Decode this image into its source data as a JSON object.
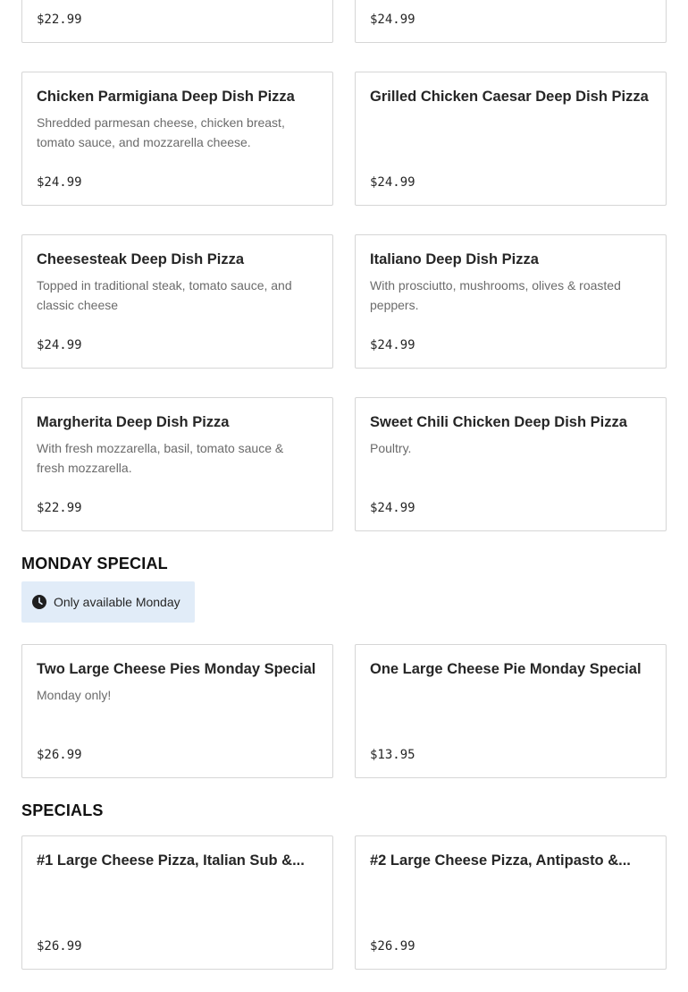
{
  "top_items": [
    {
      "price": "$22.99"
    },
    {
      "price": "$24.99"
    }
  ],
  "pizza_items": [
    {
      "name": "Chicken Parmigiana Deep Dish Pizza",
      "description": "Shredded parmesan cheese, chicken breast, tomato sauce, and mozzarella cheese.",
      "price": "$24.99"
    },
    {
      "name": "Grilled Chicken Caesar Deep Dish Pizza",
      "description": "",
      "price": "$24.99"
    },
    {
      "name": "Cheesesteak Deep Dish Pizza",
      "description": "Topped in traditional steak, tomato sauce, and classic cheese",
      "price": "$24.99"
    },
    {
      "name": "Italiano Deep Dish Pizza",
      "description": "With prosciutto, mushrooms, olives & roasted peppers.",
      "price": "$24.99"
    },
    {
      "name": "Margherita Deep Dish Pizza",
      "description": "With fresh mozzarella, basil, tomato sauce & fresh mozzarella.",
      "price": "$22.99"
    },
    {
      "name": "Sweet Chili Chicken Deep Dish Pizza",
      "description": "Poultry.",
      "price": "$24.99"
    }
  ],
  "monday_special": {
    "title": "MONDAY SPECIAL",
    "availability": "Only available Monday",
    "availability_icon": "clock-icon",
    "items": [
      {
        "name": "Two Large Cheese Pies Monday Special",
        "description": "Monday only!",
        "price": "$26.99"
      },
      {
        "name": "One Large Cheese Pie Monday Special",
        "description": "",
        "price": "$13.95"
      }
    ]
  },
  "specials": {
    "title": "SPECIALS",
    "items": [
      {
        "name": "#1 Large Cheese Pizza, Italian Sub &...",
        "description": "",
        "price": "$26.99"
      },
      {
        "name": "#2 Large Cheese Pizza, Antipasto &...",
        "description": "",
        "price": "$26.99"
      }
    ]
  },
  "colors": {
    "notice_background": "#e1ecf8",
    "card_border": "#d6d6d6",
    "description_text": "#6b6b6b"
  }
}
